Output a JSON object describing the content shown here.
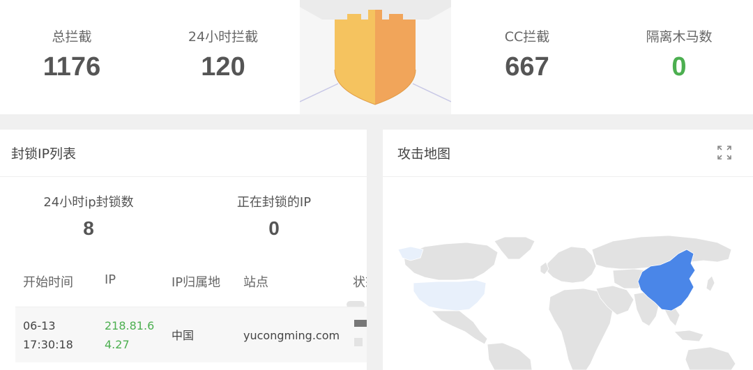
{
  "top_stats": {
    "total_block": {
      "label": "总拦截",
      "value": "1176"
    },
    "block_24h": {
      "label": "24小时拦截",
      "value": "120"
    },
    "cc_block": {
      "label": "CC拦截",
      "value": "667"
    },
    "trojan_isolated": {
      "label": "隔离木马数",
      "value": "0"
    }
  },
  "blocked_ip_panel": {
    "title": "封锁IP列表",
    "stats": [
      {
        "label": "24小时ip封锁数",
        "value": "8"
      },
      {
        "label": "正在封锁的IP",
        "value": "0"
      }
    ],
    "columns": [
      "开始时间",
      "IP",
      "IP归属地",
      "站点",
      "状态"
    ],
    "rows": [
      {
        "time_line1": "06-13",
        "time_line2": "17:30:18",
        "ip_line1": "218.81.6",
        "ip_line2": "4.27",
        "location": "中国",
        "site": "yucongming.com"
      }
    ]
  },
  "attack_map_panel": {
    "title": "攻击地图",
    "highlight_color": "#4a86e8",
    "secondary_color": "#e8f0fb",
    "land_color": "#e2e2e2"
  },
  "colors": {
    "green": "#4caf50",
    "shield_light": "#f5c35f",
    "shield_dark": "#f1a55a"
  }
}
